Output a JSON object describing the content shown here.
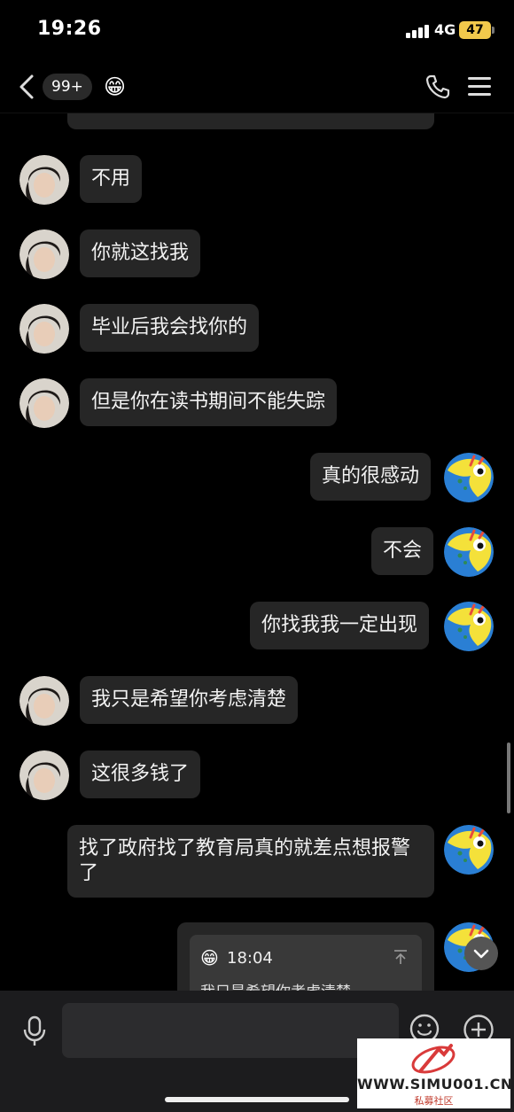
{
  "status_bar": {
    "time": "19:26",
    "network": "4G",
    "battery": "47"
  },
  "nav": {
    "unread_badge": "99+",
    "title_emoji": "😁"
  },
  "messages": [
    {
      "side": "left",
      "text": "不用"
    },
    {
      "side": "left",
      "text": "你就这找我"
    },
    {
      "side": "left",
      "text": "毕业后我会找你的"
    },
    {
      "side": "left",
      "text": "但是你在读书期间不能失踪"
    },
    {
      "side": "right",
      "text": "真的很感动"
    },
    {
      "side": "right",
      "text": "不会"
    },
    {
      "side": "right",
      "text": "你找我我一定出现"
    },
    {
      "side": "left",
      "text": "我只是希望你考虑清楚"
    },
    {
      "side": "left",
      "text": "这很多钱了"
    },
    {
      "side": "right",
      "text": "找了政府找了教育局真的就差点想报警了"
    }
  ],
  "quoted_message": {
    "emoji": "😁",
    "time": "18:04",
    "text": "我只是希望你考虑清楚"
  },
  "colors": {
    "background": "#000000",
    "bubble": "#262626",
    "battery": "#f2c94c"
  },
  "icons": {
    "back": "chevron-left-icon",
    "call": "phone-icon",
    "menu": "hamburger-menu-icon",
    "mic": "microphone-icon",
    "emoji": "smiley-icon",
    "plus": "plus-circle-icon",
    "scroll_down": "chevron-down-icon",
    "pin": "arrow-up-to-top-icon"
  },
  "watermark": {
    "url": "WWW.SIMU001.CN",
    "subtitle": "私募社区"
  }
}
